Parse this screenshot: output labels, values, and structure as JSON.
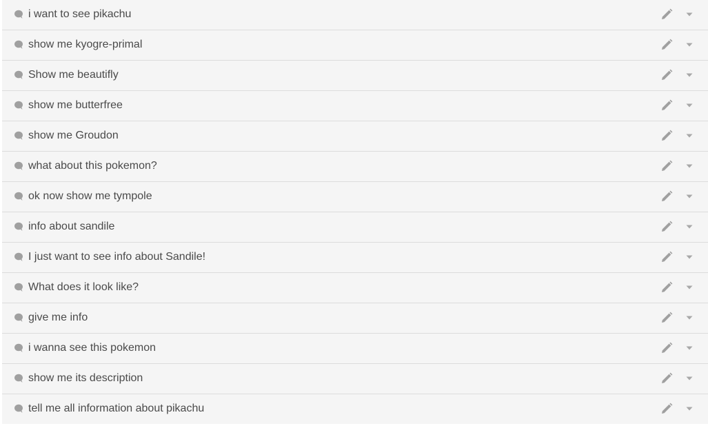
{
  "colors": {
    "row_background": "#f5f5f5",
    "divider": "#dcdcdc",
    "text": "#4a4a4a",
    "icon": "#a0a0a0"
  },
  "icons": {
    "row_leading": "speech-bubble-icon",
    "edit": "pencil-icon",
    "expand": "caret-down-icon"
  },
  "items": [
    {
      "label": "i want to see pikachu"
    },
    {
      "label": "show me kyogre-primal"
    },
    {
      "label": "Show me beautifly"
    },
    {
      "label": "show me butterfree"
    },
    {
      "label": "show me Groudon"
    },
    {
      "label": "what about this pokemon?"
    },
    {
      "label": "ok now show me tympole"
    },
    {
      "label": "info about sandile"
    },
    {
      "label": "I just want to see info about Sandile!"
    },
    {
      "label": "What does it look like?"
    },
    {
      "label": "give me info"
    },
    {
      "label": "i wanna see this pokemon"
    },
    {
      "label": "show me its description"
    },
    {
      "label": "tell me all information about pikachu"
    }
  ]
}
